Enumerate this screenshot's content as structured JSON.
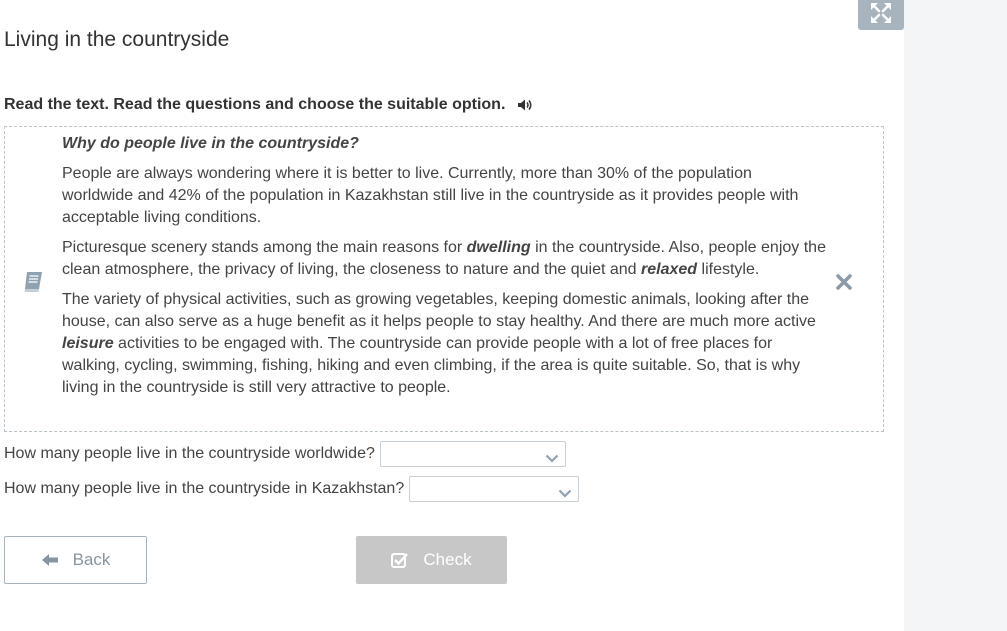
{
  "page": {
    "title": "Living in the countryside",
    "instruction": "Read the text. Read the questions and choose the suitable option."
  },
  "passage": {
    "heading": "Why do people live in the countryside?",
    "p1": "People are always wondering where it is better to live. Currently, more than 30% of the population worldwide and 42% of the population in Kazakhstan still live in the countryside as it provides people with acceptable living conditions.",
    "p2": {
      "a": "Picturesque scenery stands among the main reasons for ",
      "b1": "dwelling",
      "c": " in the countryside. Also, people enjoy the clean atmosphere, the privacy of living, the closeness to nature and the quiet and ",
      "b2": "relaxed",
      "d": " lifestyle."
    },
    "p3": {
      "a": "The variety of physical activities, such as growing vegetables, keeping domestic animals, looking after the house, can also serve as a huge benefit as it helps people to stay healthy. And there are much more active ",
      "b1": "leisure",
      "c": " activities to be engaged with. The countryside can provide people with a lot of free places for walking, cycling, swimming, fishing, hiking and even climbing, if the area is quite suitable. So, that is why living in the countryside is still very attractive to people."
    }
  },
  "questions": [
    {
      "label": "How many people live in the countryside worldwide?",
      "selected": ""
    },
    {
      "label": "How many people live in the countryside in Kazakhstan?",
      "selected": ""
    }
  ],
  "buttons": {
    "back": "Back",
    "check": "Check"
  },
  "icons": {
    "fullscreen": "fullscreen-icon",
    "speaker": "speaker-icon",
    "book": "book-icon",
    "close": "close-icon",
    "back": "arrow-left-icon",
    "check": "checkbox-check-icon",
    "dropdown": "chevron-down-icon"
  },
  "colors": {
    "accent": "#a7b4bd",
    "check_bg": "#c7c7c7",
    "text": "#444444"
  }
}
